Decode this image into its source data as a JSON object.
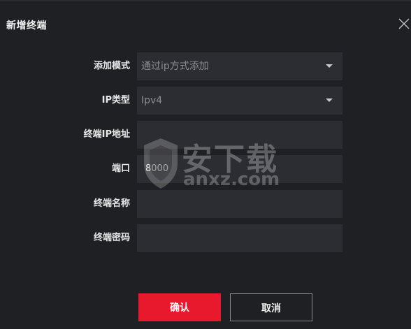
{
  "dialog": {
    "title": "新增终端",
    "close_icon": "close-icon"
  },
  "form": {
    "add_mode": {
      "label": "添加模式",
      "value": "通过ip方式添加"
    },
    "ip_type": {
      "label": "IP类型",
      "value": "Ipv4"
    },
    "terminal_ip": {
      "label": "终端IP地址",
      "value": ""
    },
    "port": {
      "label": "端口",
      "value": "8000"
    },
    "terminal_name": {
      "label": "终端名称",
      "value": ""
    },
    "terminal_password": {
      "label": "终端密码",
      "value": ""
    }
  },
  "buttons": {
    "confirm": "确认",
    "cancel": "取消"
  },
  "watermark": {
    "text": "安下载",
    "sub": "anxz.com"
  },
  "colors": {
    "background": "#1f2023",
    "field": "#2c2d32",
    "accent": "#e8192c"
  }
}
